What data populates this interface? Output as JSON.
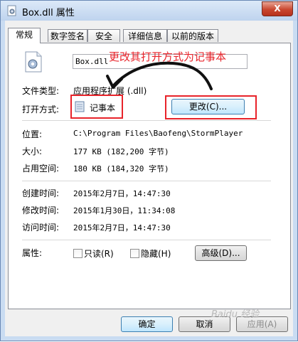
{
  "window": {
    "title": "Box.dll 属性",
    "close_label": "X"
  },
  "tabs": [
    {
      "label": "常规",
      "active": true
    },
    {
      "label": "数字签名",
      "active": false
    },
    {
      "label": "安全",
      "active": false
    },
    {
      "label": "详细信息",
      "active": false
    },
    {
      "label": "以前的版本",
      "active": false
    }
  ],
  "general": {
    "file_name": "Box.dll",
    "annotation": "更改其打开方式为记事本",
    "file_type_label": "文件类型:",
    "file_type_value": "应用程序扩展 (.dll)",
    "open_with_label": "打开方式:",
    "open_with_value": "记事本",
    "change_button": "更改(C)...",
    "location_label": "位置:",
    "location_value": "C:\\Program Files\\Baofeng\\StormPlayer",
    "size_label": "大小:",
    "size_value": "177 KB (182,200 字节)",
    "size_on_disk_label": "占用空间:",
    "size_on_disk_value": "180 KB (184,320 字节)",
    "created_label": "创建时间:",
    "created_value": "2015年2月7日，14:47:30",
    "modified_label": "修改时间:",
    "modified_value": "2015年1月30日，11:34:08",
    "accessed_label": "访问时间:",
    "accessed_value": "2015年2月7日，14:47:30",
    "attributes_label": "属性:",
    "readonly_label": "只读(R)",
    "hidden_label": "隐藏(H)",
    "advanced_button": "高级(D)..."
  },
  "footer": {
    "ok": "确定",
    "cancel": "取消",
    "apply": "应用(A)"
  },
  "watermark": "Baidu 经验",
  "colors": {
    "annotation_red": "#e8232a",
    "titlebar": "#c9dcf2"
  }
}
